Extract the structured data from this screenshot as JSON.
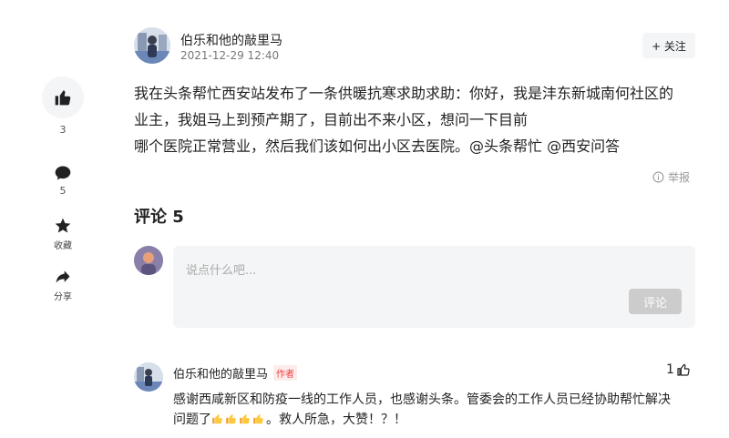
{
  "post": {
    "author": "伯乐和他的敲里马",
    "time": "2021-12-29 12:40",
    "follow_label": "+ 关注",
    "body_lines": [
      "我在头条帮忙西安站发布了一条供暖抗寒求助求助：你好，我是沣东新城南何社区的",
      "业主，我姐马上到预产期了，目前出不来小区，想问一下目前",
      "哪个医院正常营业，然后我们该如何出小区去医院。@头条帮忙 @西安问答"
    ],
    "report_label": "举报"
  },
  "rail": {
    "like_count": "3",
    "comment_count": "5",
    "collect_label": "收藏",
    "share_label": "分享"
  },
  "comments": {
    "title": "评论 5",
    "input_placeholder": "说点什么吧...",
    "submit_label": "评论",
    "items": [
      {
        "author": "伯乐和他的敲里马",
        "tag": "作者",
        "like_count": "1",
        "text_line1": "感谢西咸新区和防疫一线的工作人员，也感谢头条。管委会的工作人员已经协助帮忙解决",
        "text_line2_prefix": "问题了",
        "text_line2_suffix": "。救人所急，大赞！？！"
      }
    ]
  },
  "colors": {
    "accent_red": "#f04142",
    "rail_bg": "#f4f5f6",
    "disabled_button": "#cccccc"
  },
  "icons": [
    "thumb-up-icon",
    "comment-bubble-icon",
    "star-icon",
    "share-arrow-icon",
    "info-circle-icon",
    "thumbs-up-emoji"
  ]
}
